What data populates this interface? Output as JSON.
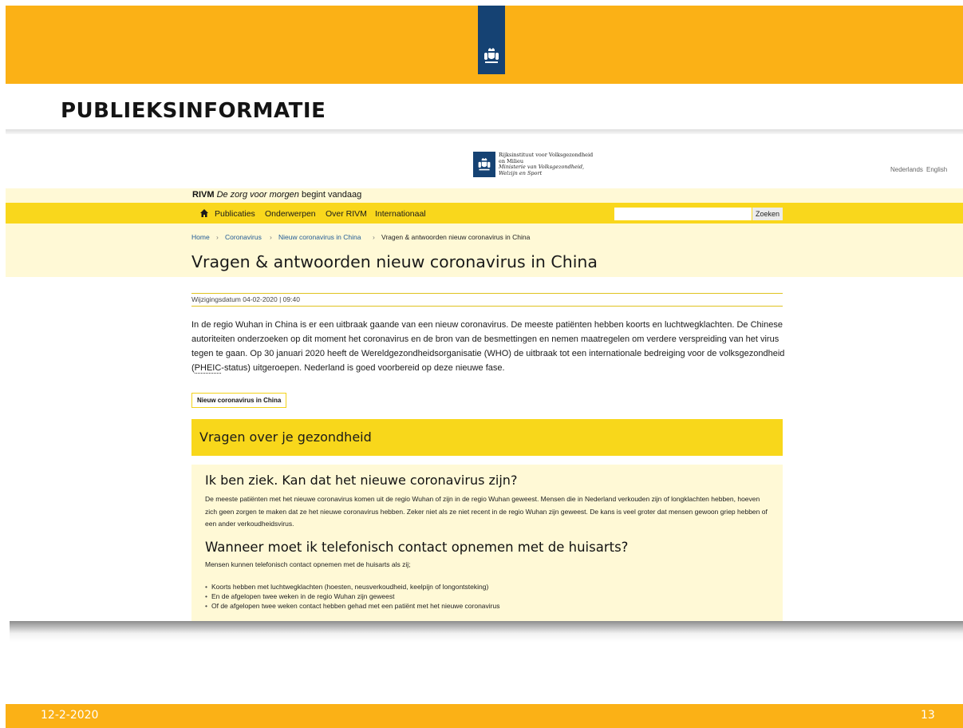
{
  "slide": {
    "title": "PUBLIEKSINFORMATIE",
    "footer_date": "12-2-2020",
    "footer_page": "13",
    "colors": {
      "band": "#fbb116",
      "emblem": "#154273"
    }
  },
  "emblem_icon": "coat-of-arms-icon",
  "screenshot": {
    "header": {
      "logo_icon": "coat-of-arms-icon",
      "org_line1": "Rijksinstituut voor Volksgezondheid",
      "org_line2": "en Milieu",
      "ministry_line1": "Ministerie van Volksgezondheid,",
      "ministry_line2": "Welzijn en Sport",
      "lang_nl": "Nederlands",
      "lang_en": "English"
    },
    "slogan": {
      "brand": "RIVM",
      "italic": "De zorg voor morgen",
      "rest": "begint vandaag"
    },
    "nav": {
      "home_icon": "home-icon",
      "items": [
        "Publicaties",
        "Onderwerpen",
        "Over RIVM",
        "Internationaal"
      ],
      "search_placeholder": "",
      "search_button": "Zoeken"
    },
    "breadcrumb": [
      "Home",
      "Coronavirus",
      "Nieuw coronavirus in China",
      "Vragen & antwoorden nieuw coronavirus in China"
    ],
    "breadcrumb_sep": "›",
    "page_title": "Vragen & antwoorden nieuw coronavirus in China",
    "date_label": "Wijzigingsdatum 04-02-2020 | 09:40",
    "intro": {
      "before_abbr": "In de regio Wuhan in China is er een uitbraak gaande van een nieuw coronavirus. De meeste patiënten hebben koorts en luchtwegklachten. De Chinese autoriteiten onderzoeken op dit moment het coronavirus en de bron van de besmettingen en nemen maatregelen om verdere verspreiding van het virus tegen te gaan. Op 30 januari 2020 heeft de Wereldgezondheidsorganisatie (WHO) de uitbraak tot een internationale bedreiging voor de volksgezondheid (",
      "abbr": "PHEIC",
      "after_abbr": "-status) uitgeroepen. Nederland is goed voorbereid op deze nieuwe fase."
    },
    "tag": "Nieuw coronavirus in China",
    "section_heading": "Vragen over je gezondheid",
    "qa": [
      {
        "question": "Ik ben ziek. Kan dat het nieuwe coronavirus zijn?",
        "answer": "De meeste patiënten met het nieuwe coronavirus komen uit de regio Wuhan of zijn in de regio Wuhan geweest. Mensen die in Nederland verkouden zijn of longklachten hebben, hoeven zich geen zorgen te maken dat ze het nieuwe coronavirus hebben. Zeker niet als ze niet recent in de regio Wuhan zijn geweest. De kans is veel groter dat mensen gewoon griep hebben of een ander verkoudheidsvirus."
      },
      {
        "question": "Wanneer moet ik telefonisch contact opnemen met de huisarts?",
        "answer": "Mensen kunnen telefonisch contact opnemen met de huisarts als zij;",
        "bullets": [
          "Koorts hebben met luchtwegklachten (hoesten, neusverkoudheid, keelpijn of longontsteking)",
          "En de afgelopen twee weken in de regio Wuhan zijn geweest",
          "Of de afgelopen twee weken contact hebben gehad met een patiënt met het nieuwe coronavirus"
        ]
      }
    ]
  }
}
